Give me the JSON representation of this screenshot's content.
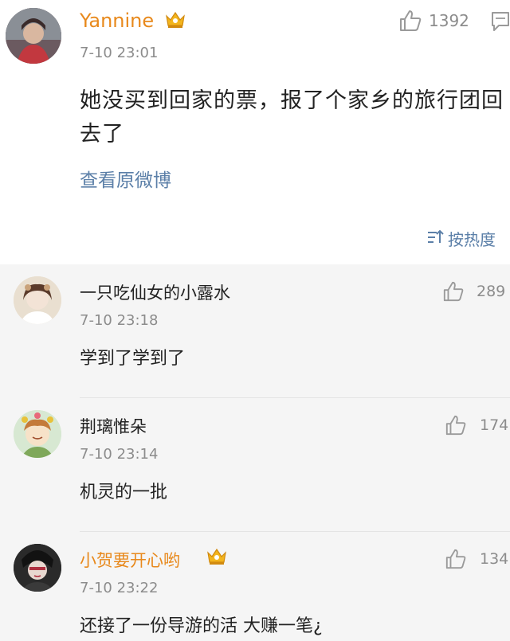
{
  "original_post": {
    "username": "Yannine",
    "time": "7-10 23:01",
    "likes": "1392",
    "content": "她没买到回家的票，报了个家乡的旅行团回去了",
    "view_original": "查看原微博",
    "sort_label": "按热度"
  },
  "replies": [
    {
      "username": "一只吃仙女的小露水",
      "time": "7-10 23:18",
      "likes": "289",
      "text": "学到了学到了"
    },
    {
      "username": "荆璃惟朵",
      "time": "7-10 23:14",
      "likes": "174",
      "text": "机灵的一批"
    },
    {
      "username": "小贺要开心哟",
      "time": "7-10 23:22",
      "likes": "134",
      "text": "还接了一份导游的活  大赚一笔¿"
    }
  ],
  "colors": {
    "vip_name": "#e8891c",
    "link": "#5b7fa8",
    "muted": "#8c8c8c",
    "reply_bg": "#f5f5f5"
  },
  "icons": [
    "crown-badge-icon",
    "thumbs-up-icon",
    "comment-icon",
    "sort-icon"
  ]
}
